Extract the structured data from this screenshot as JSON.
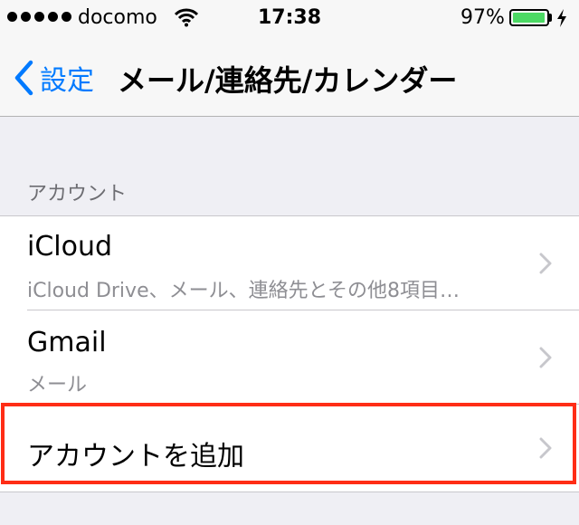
{
  "status_bar": {
    "carrier": "docomo",
    "time": "17:38",
    "battery_percent_label": "97%",
    "battery_level": 0.97,
    "icons": [
      "signal-dots-icon",
      "wifi-icon",
      "battery-icon",
      "charging-bolt-icon"
    ]
  },
  "nav": {
    "back_label": "設定",
    "title": "メール/連絡先/カレンダー"
  },
  "accounts_section": {
    "header": "アカウント",
    "items": [
      {
        "title": "iCloud",
        "subtitle": "iCloud Drive、メール、連絡先とその他8項目…"
      },
      {
        "title": "Gmail",
        "subtitle": "メール"
      },
      {
        "title": "アカウントを追加"
      }
    ]
  },
  "colors": {
    "accent": "#007aff",
    "highlight_border": "#ff2d16",
    "battery_fill": "#4cd964",
    "background": "#efeff4"
  }
}
